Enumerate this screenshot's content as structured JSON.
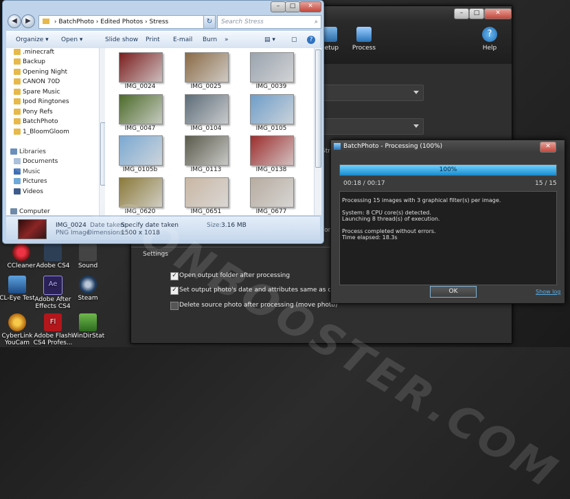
{
  "desktop": {
    "icons": [
      {
        "label": "CCleaner"
      },
      {
        "label": "Adobe CS4"
      },
      {
        "label": "Sound"
      },
      {
        "label": "CL-Eye Test"
      },
      {
        "label": "Adobe After Effects CS4"
      },
      {
        "label": "Steam"
      },
      {
        "label": "CyberLink YouCam"
      },
      {
        "label": "Adobe Flash CS4 Profes..."
      },
      {
        "label": "WinDirStat"
      }
    ]
  },
  "explorer": {
    "breadcrumb": [
      "BatchPhoto",
      "Edited Photos",
      "Stress"
    ],
    "breadcrumb_sep": "›",
    "search_placeholder": "Search Stress",
    "commands": {
      "organize": "Organize ▾",
      "open": "Open ▾",
      "slideshow": "Slide show",
      "print": "Print",
      "email": "E-mail",
      "burn": "Burn",
      "more": "»"
    },
    "nav_items": [
      ".minecraft",
      "Backup",
      "Opening Night",
      "CANON 70D",
      "Spare Music",
      "Ipod Ringtones",
      "Pony Refs",
      "BatchPhoto",
      "1_BloomGloom"
    ],
    "libraries": {
      "label": "Libraries",
      "items": [
        "Documents",
        "Music",
        "Pictures",
        "Videos"
      ]
    },
    "computer_label": "Computer",
    "thumbnails": [
      {
        "name": "IMG_0024",
        "palette": "#7b1e1e"
      },
      {
        "name": "IMG_0025",
        "palette": "#8a6a45"
      },
      {
        "name": "IMG_0039",
        "palette": "#9aa3ae"
      },
      {
        "name": "IMG_0047",
        "palette": "#4d6b2a"
      },
      {
        "name": "IMG_0104",
        "palette": "#5d6c78"
      },
      {
        "name": "IMG_0105",
        "palette": "#6e9dc9"
      },
      {
        "name": "IMG_0105b",
        "palette": "#7ba9d2"
      },
      {
        "name": "IMG_0113",
        "palette": "#5a5a4c"
      },
      {
        "name": "IMG_0138",
        "palette": "#9c2d2d"
      },
      {
        "name": "IMG_0620",
        "palette": "#8b7a3a"
      },
      {
        "name": "IMG_0651",
        "palette": "#c9b7a4"
      },
      {
        "name": "IMG_0677",
        "palette": "#b7aca0"
      }
    ],
    "details": {
      "filename": "IMG_0024",
      "type": "PNG Image",
      "date_taken_label": "Date taken:",
      "date_taken_value": "Specify date taken",
      "dimensions_label": "Dimensions:",
      "dimensions_value": "1500 x 1018",
      "size_label": "Size:",
      "size_value": "3.16 MB"
    }
  },
  "batchphoto": {
    "toolbar": {
      "setup": "Setup",
      "process": "Process",
      "help": "Help"
    },
    "partial_labels": {
      "stre": "Stre",
      "for": "for"
    },
    "settings_label": "Settings",
    "options": [
      {
        "label": "Open output folder after processing",
        "checked": true
      },
      {
        "label": "Set output photo's date and attributes same as original",
        "checked": true
      },
      {
        "label": "Delete source photo after processing (move photo)",
        "checked": false
      }
    ]
  },
  "dialog": {
    "title": "BatchPhoto - Processing (100%)",
    "progress_percent": 100,
    "progress_label": "100%",
    "time": "00:18 / 00:17",
    "count": "15 / 15",
    "log_lines": [
      "Processing 15 images with 3 graphical filter(s) per image.",
      "",
      "System: 8 CPU core(s) detected.",
      "Launching 8 thread(s) of execution.",
      "",
      "Process completed without errors.",
      "Time elapsed: 18.3s"
    ],
    "ok_label": "OK",
    "show_log": "Show log"
  },
  "watermark": "DRAGONBOOSTER.COM",
  "colors": {
    "accent_blue": "#1b8ccc",
    "dark_bg": "#2f2f2f",
    "explorer_frame": "#bfd4ea"
  }
}
